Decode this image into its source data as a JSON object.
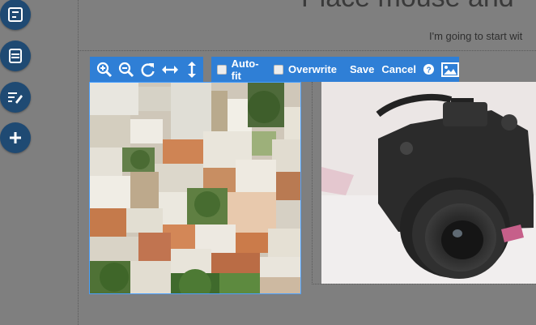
{
  "page": {
    "heading": "Place mouse and",
    "text": "I'm going to start wit"
  },
  "sidebar": {
    "buttons": [
      {
        "icon": "layout-icon"
      },
      {
        "icon": "stack-icon"
      },
      {
        "icon": "edit-text-icon"
      },
      {
        "icon": "plus-icon"
      }
    ]
  },
  "toolbar": {
    "zoom_tools": [
      "zoom-in-icon",
      "zoom-out-icon",
      "rotate-icon",
      "fit-width-icon",
      "fit-height-icon"
    ],
    "autofit_label": "Auto-fit",
    "autofit_checked": false,
    "overwrite_label": "Overwrite",
    "overwrite_checked": false,
    "save_label": "Save",
    "cancel_label": "Cancel",
    "help_icon": "question-circle-icon",
    "image_icon": "image-icon",
    "accent_color": "#2f7fd6"
  },
  "images": {
    "left": "city-rooftops-photo",
    "right": "camera-photo"
  }
}
